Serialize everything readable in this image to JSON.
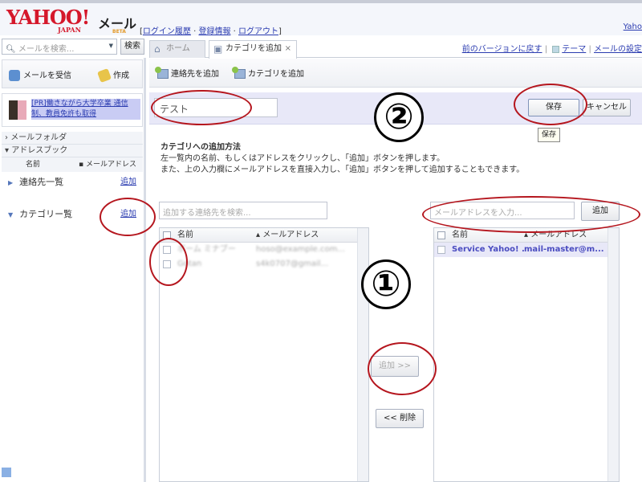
{
  "header": {
    "logo_main": "YAHOO!",
    "logo_sub": "JAPAN",
    "app_title": "メール",
    "beta_badge": "BETA",
    "links": [
      "ログイン履歴",
      "登録情報",
      "ログアウト"
    ],
    "right_link": "Yaho"
  },
  "search": {
    "placeholder": "メールを検索...",
    "button_label": "検索"
  },
  "tabs": [
    {
      "label": "ホーム",
      "icon": "home-icon",
      "active": false
    },
    {
      "label": "カテゴリを追加",
      "icon": "folder-icon",
      "active": true,
      "closable": true
    }
  ],
  "top_right_links": {
    "revert": "前のバージョンに戻す",
    "theme": "テーマ",
    "settings": "メールの設定"
  },
  "sidebar": {
    "receive_label": "メールを受信",
    "compose_label": "作成",
    "ad_text": "[PR]働きながら大学卒業 通信制、教員免許も取得",
    "folders_label": "メールフォルダ",
    "addressbook_label": "アドレスブック",
    "columns": {
      "name": "名前",
      "email": "メールアドレス"
    },
    "items": [
      {
        "label": "連絡先一覧",
        "action": "追加"
      },
      {
        "label": "カテゴリー覧",
        "action": "追加"
      }
    ]
  },
  "toolbar": {
    "add_contact": "連絡先を追加",
    "add_category": "カテゴリを追加"
  },
  "form": {
    "category_name_value": "テスト",
    "save_label": "保存",
    "cancel_label": "キャンセル",
    "tooltip": "保存"
  },
  "help": {
    "title": "カテゴリへの追加方法",
    "line1": "左一覧内の名前、もしくはアドレスをクリックし、「追加」ボタンを押します。",
    "line2": "また、上の入力欄にメールアドレスを直接入力し、「追加」ボタンを押して追加することもできます。"
  },
  "left_panel": {
    "search_placeholder": "追加する連絡先を検索...",
    "columns": {
      "name": "名前",
      "email": "メールアドレス"
    },
    "rows": [
      {
        "name": "ボーム ミナブー",
        "email": "hoso@example.com..."
      },
      {
        "name": "Gotan",
        "email": "s4k0707@gmail..."
      }
    ]
  },
  "right_panel": {
    "email_placeholder": "メールアドレスを入力...",
    "add_label": "追加",
    "columns": {
      "name": "名前",
      "email": "メールアドレス"
    },
    "rows": [
      {
        "name": "Service Yahoo! ...",
        "email": "mail-master@m..."
      }
    ]
  },
  "move_buttons": {
    "add": "追加 >>",
    "remove": "<< 削除"
  },
  "annotations": {
    "step1": "①",
    "step2": "②",
    "circle_color": "#b5161e"
  }
}
